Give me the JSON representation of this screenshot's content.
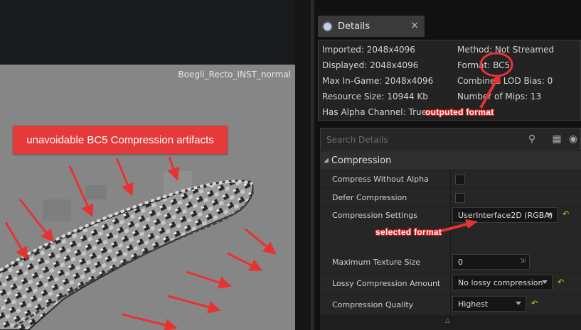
{
  "viewport": {
    "texture_name": "Boegli_Recto_INST_normal",
    "annotation": "unavoidable BC5 Compression artifacts"
  },
  "details_tab": {
    "title": "Details",
    "close": "×"
  },
  "info": {
    "imported": "Imported: 2048x4096",
    "displayed": "Displayed: 2048x4096",
    "max_in_game": "Max In-Game: 2048x4096",
    "resource_size": "Resource Size: 10944 Kb",
    "has_alpha": "Has Alpha Channel: True",
    "method": "Method: Not Streamed",
    "format": "Format: BC5",
    "lod_bias": "Combined LOD Bias: 0",
    "num_mips": "Number of Mips: 13"
  },
  "search": {
    "placeholder": "Search Details"
  },
  "compression": {
    "category": "Compression",
    "rows": {
      "compress_without_alpha": "Compress Without Alpha",
      "defer_compression": "Defer Compression",
      "compression_settings": "Compression Settings",
      "max_texture_size": "Maximum Texture Size",
      "lossy_compression_amount": "Lossy Compression Amount",
      "compression_quality": "Compression Quality"
    },
    "values": {
      "compression_settings": "UserInterface2D (RGBA)",
      "max_texture_size": "0",
      "lossy_compression_amount": "No lossy compression",
      "compression_quality": "Highest"
    }
  },
  "callouts": {
    "outputted": "outputed format",
    "selected": "selected format"
  },
  "colors": {
    "annotation_red": "#e43a3a",
    "reset_yellow": "#e6c91a"
  }
}
